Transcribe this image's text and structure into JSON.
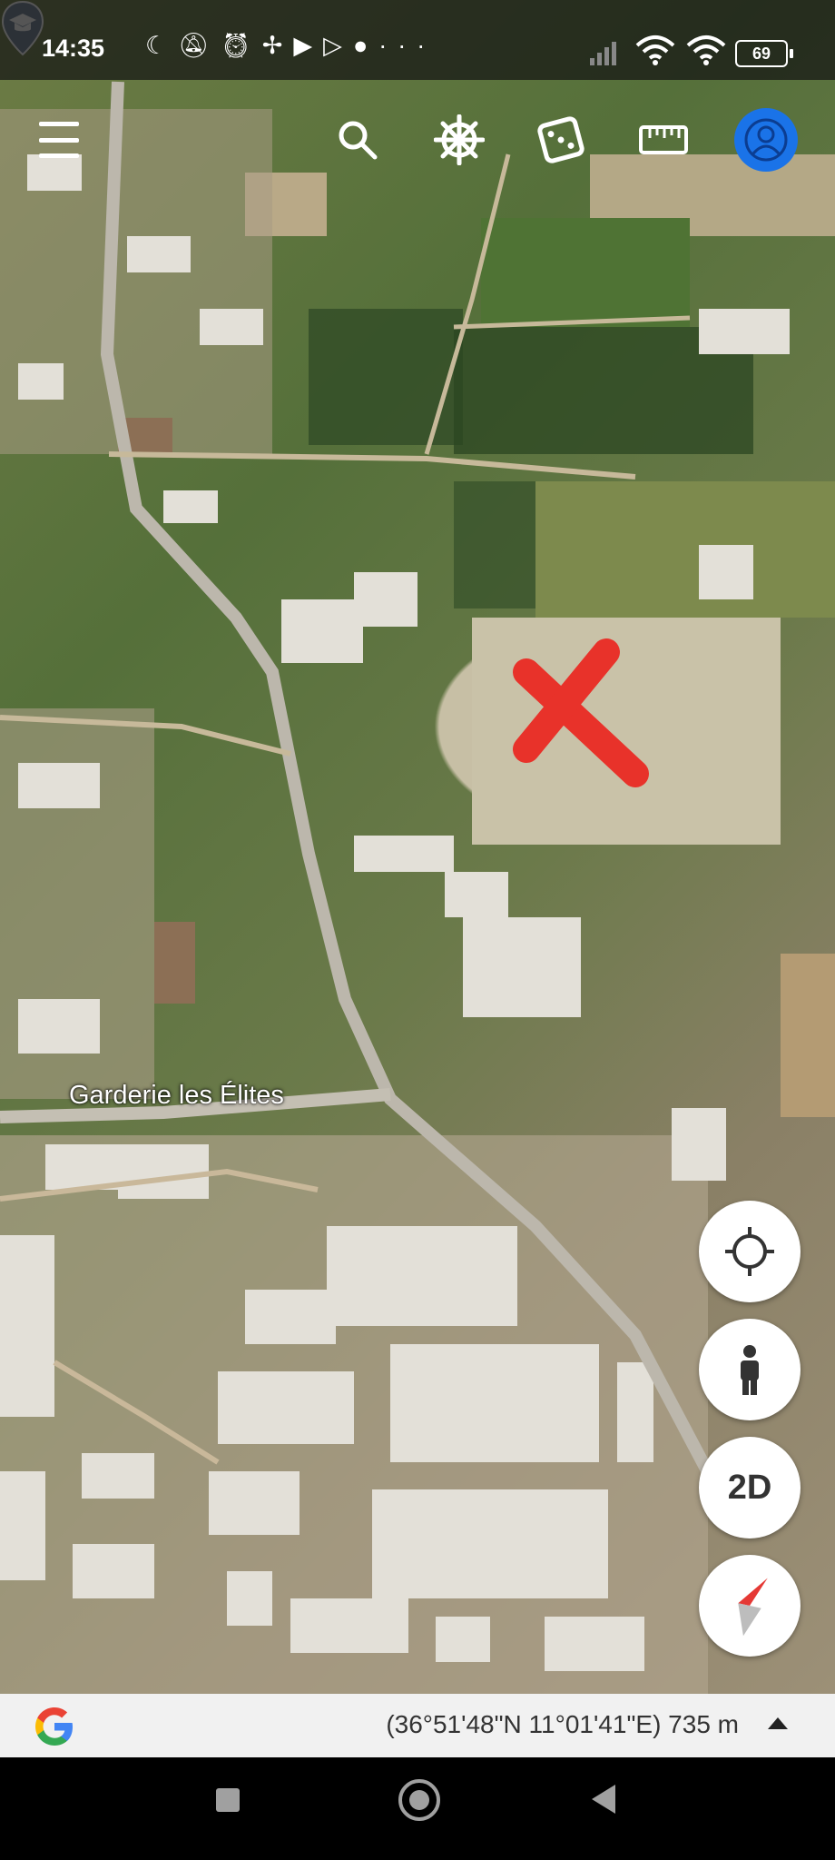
{
  "status_bar": {
    "time": "14:35",
    "left_icons": [
      "moon-icon",
      "mute-icon",
      "alarm-icon",
      "fan-icon",
      "youtube-icon",
      "play-icon",
      "maps-icon",
      "more-icon"
    ],
    "right_icons": [
      "signal-icon",
      "wifi-icon",
      "wifi-icon"
    ],
    "battery": "69"
  },
  "toolbar": {
    "icons": [
      "menu-icon",
      "search-icon",
      "voyager-icon",
      "dice-icon",
      "ruler-icon",
      "account-icon"
    ]
  },
  "map": {
    "place_label": "Garderie les Élites",
    "place_icon": "school-icon",
    "marker": "red-x-marker"
  },
  "controls": {
    "mode_label": "2D",
    "icons": [
      "my-location-icon",
      "pegman-icon",
      "compass-icon"
    ]
  },
  "info_bar": {
    "logo": "google-logo",
    "coordinates": "(36°51'48\"N 11°01'41\"E) 735 m"
  },
  "colors": {
    "marker": "#e8322a",
    "accent": "#1a73e8"
  }
}
